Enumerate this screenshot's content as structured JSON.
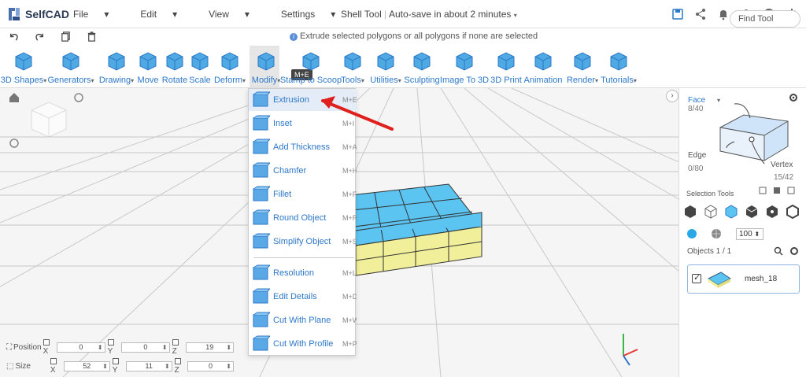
{
  "app": {
    "name": "SelfCAD"
  },
  "menu": [
    "File",
    "Edit",
    "View",
    "Settings"
  ],
  "title": {
    "tool": "Shell Tool",
    "autosave": "Auto-save in about 2 minutes"
  },
  "hint": "Extrude selected polygons or all polygons if none are selected",
  "toolbar": [
    {
      "label": "3D Shapes",
      "caret": true
    },
    {
      "label": "Generators",
      "caret": true
    },
    {
      "label": "Drawing",
      "caret": true
    },
    {
      "label": "Move",
      "caret": false
    },
    {
      "label": "Rotate",
      "caret": false
    },
    {
      "label": "Scale",
      "caret": false
    },
    {
      "label": "Deform",
      "caret": true
    },
    {
      "label": "Modify",
      "caret": true
    },
    {
      "label": "Stamp to Scoop",
      "caret": false
    },
    {
      "label": "Tools",
      "caret": true
    },
    {
      "label": "Utilities",
      "caret": true
    },
    {
      "label": "Sculpting",
      "caret": false
    },
    {
      "label": "Image To 3D",
      "caret": false
    },
    {
      "label": "3D Print",
      "caret": false
    },
    {
      "label": "Animation",
      "caret": false
    },
    {
      "label": "Render",
      "caret": true
    },
    {
      "label": "Tutorials",
      "caret": true
    }
  ],
  "find_tool": "Find Tool",
  "tooltip": "M+E",
  "modify_menu": [
    {
      "label": "Extrusion",
      "key": "M+E"
    },
    {
      "label": "Inset",
      "key": "M+I"
    },
    {
      "label": "Add Thickness",
      "key": "M+A"
    },
    {
      "label": "Chamfer",
      "key": "M+H"
    },
    {
      "label": "Fillet",
      "key": "M+F"
    },
    {
      "label": "Round Object",
      "key": "M+R"
    },
    {
      "label": "Simplify Object",
      "key": "M+S"
    },
    {
      "label": "Resolution",
      "key": "M+L"
    },
    {
      "label": "Edit Details",
      "key": "M+D"
    },
    {
      "label": "Cut With Plane",
      "key": "M+W"
    },
    {
      "label": "Cut With Profile",
      "key": "M+P"
    }
  ],
  "panel": {
    "face_label": "Face",
    "face_count": "8/40",
    "edge_label": "Edge",
    "edge_count": "0/80",
    "vertex_label": "Vertex",
    "vertex_count": "15/42",
    "selection_tools": "Selection Tools",
    "opacity": "100",
    "objects_label": "Objects 1 / 1",
    "object_name": "mesh_18"
  },
  "bottom": {
    "position_label": "Position",
    "size_label": "Size",
    "position": {
      "x": "0",
      "y": "0",
      "z": "19"
    },
    "size": {
      "x": "52",
      "y": "11",
      "z": "0"
    }
  },
  "colors": {
    "accent": "#2e78c8",
    "cube_top": "#5bc4f0",
    "cube_side": "#f1ef9a",
    "arrow": "#e0201e"
  }
}
